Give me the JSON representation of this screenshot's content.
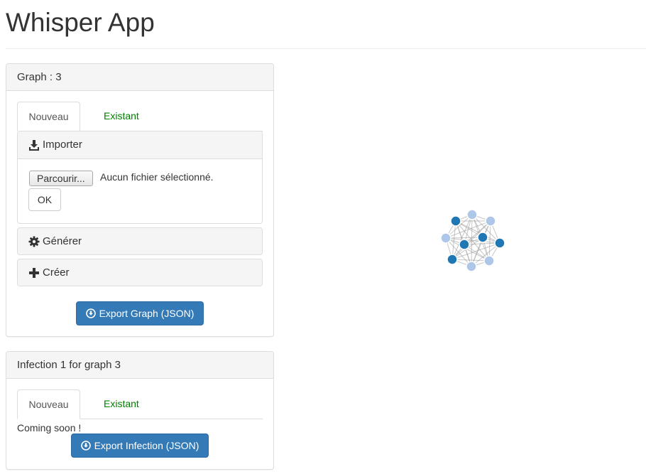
{
  "app": {
    "title": "Whisper App"
  },
  "graph_panel": {
    "heading": "Graph : 3",
    "tabs": [
      {
        "label": "Nouveau"
      },
      {
        "label": "Existant"
      }
    ],
    "import_section": {
      "label": "Importer",
      "icon": "download-icon",
      "file_button_label": "Parcourir...",
      "file_status": "Aucun fichier sélectionné.",
      "ok_label": "OK"
    },
    "generate_section": {
      "label": "Générer",
      "icon": "gear-icon"
    },
    "create_section": {
      "label": "Créer",
      "icon": "plus-icon"
    },
    "export_button_label": "Export Graph (JSON)"
  },
  "infection_panel": {
    "heading": "Infection 1 for graph 3",
    "tabs": [
      {
        "label": "Nouveau"
      },
      {
        "label": "Existant"
      }
    ],
    "message": "Coming soon !",
    "export_button_label": "Export Infection (JSON)"
  },
  "colors": {
    "primary": "#337ab7",
    "tab_inactive": "#008000",
    "node_dark": "#1f77b4",
    "node_light": "#aec7e8",
    "edge": "#999999"
  },
  "graph_viz": {
    "node_count": 10,
    "nodes": [
      {
        "group": "dark"
      },
      {
        "group": "light"
      },
      {
        "group": "light"
      },
      {
        "group": "light"
      },
      {
        "group": "dark"
      },
      {
        "group": "dark"
      },
      {
        "group": "dark"
      },
      {
        "group": "light"
      },
      {
        "group": "dark"
      },
      {
        "group": "light"
      }
    ]
  }
}
